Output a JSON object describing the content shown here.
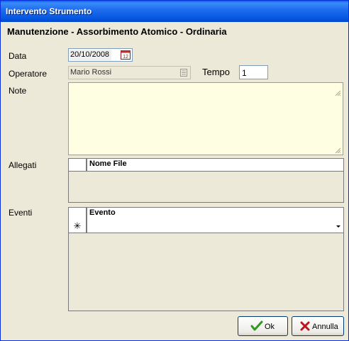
{
  "window": {
    "title": "Intervento Strumento"
  },
  "heading": "Manutenzione - Assorbimento Atomico - Ordinaria",
  "form": {
    "data_label": "Data",
    "data_value": "20/10/2008",
    "operatore_label": "Operatore",
    "operatore_value": "Mario Rossi",
    "tempo_label": "Tempo",
    "tempo_value": "1",
    "note_label": "Note",
    "note_value": ""
  },
  "allegati": {
    "label": "Allegati",
    "columns": [
      "Nome File"
    ],
    "rows": []
  },
  "eventi": {
    "label": "Eventi",
    "columns": [
      "Evento"
    ],
    "new_row_marker": "✳",
    "rows": []
  },
  "buttons": {
    "ok": "Ok",
    "annulla": "Annulla"
  },
  "icons": [
    "calendar-icon",
    "lookup-list-icon",
    "resize-grip-icon",
    "dropdown-arrow-icon",
    "check-icon",
    "x-cancel-icon"
  ],
  "colors": {
    "titlebar": "#0a5ee8",
    "note_bg": "#fefee2",
    "dialog_bg": "#ece9d8",
    "ok_check": "#2e9b1e",
    "cancel_x": "#c0141c"
  }
}
